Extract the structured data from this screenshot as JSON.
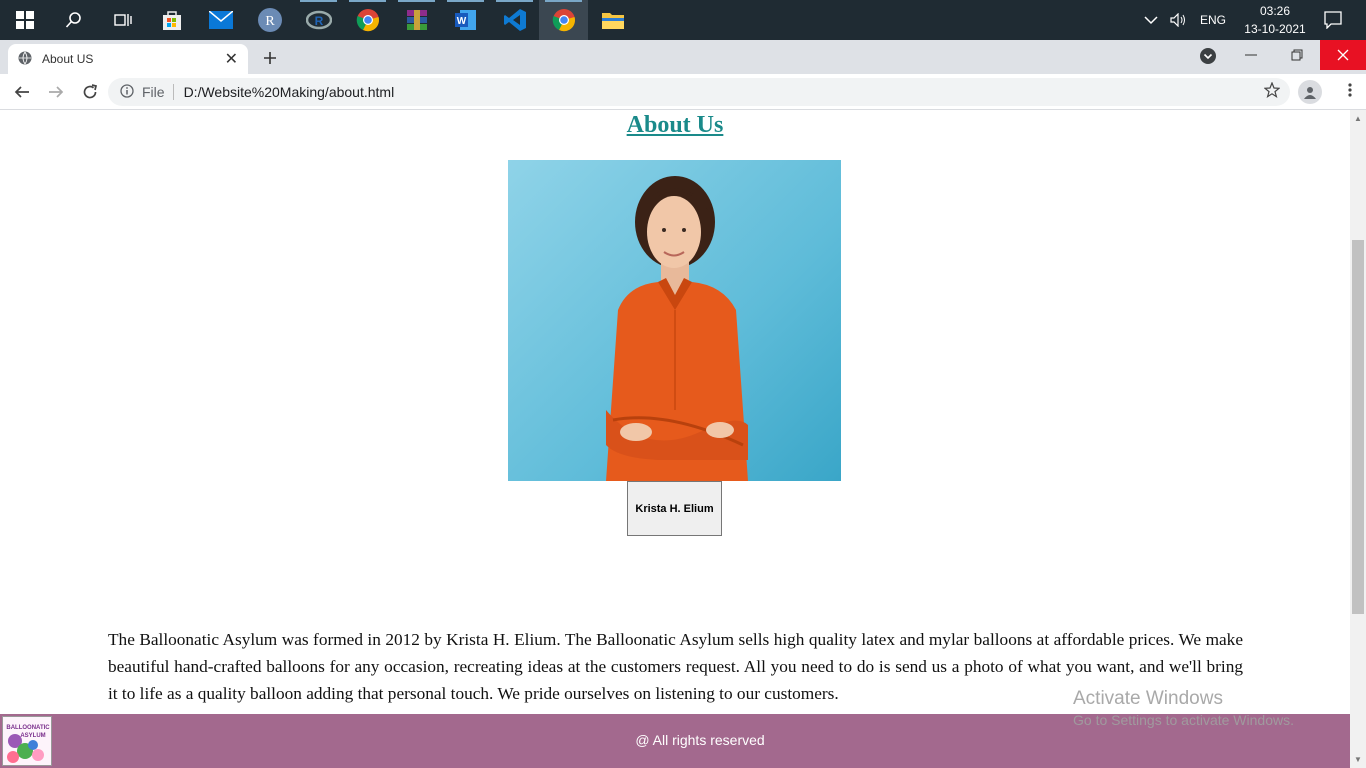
{
  "taskbar": {
    "apps": [
      "start-icon",
      "search-icon",
      "task-view-icon",
      "store-icon",
      "mail-icon",
      "r-icon",
      "rstudio-icon",
      "chrome-icon",
      "winrar-icon",
      "word-icon",
      "vscode-icon",
      "chrome-active-icon",
      "file-explorer-icon"
    ],
    "tray": {
      "language": "ENG",
      "time": "03:26",
      "date": "13-10-2021"
    }
  },
  "browser": {
    "tab_title": "About US",
    "url_prefix": "File",
    "url": "D:/Website%20Making/about.html"
  },
  "page": {
    "heading": "About Us",
    "person_name": "Krista H. Elium",
    "description": "The Balloonatic Asylum was formed in 2012 by Krista H. Elium. The Balloonatic Asylum sells high quality latex and mylar balloons at affordable prices. We make beautiful hand-crafted balloons for any occasion, recreating ideas at the customers request. All you need to do is send us a photo of what you want, and we'll bring it to life as a quality balloon adding that personal touch. We pride ourselves on listening to our customers.",
    "footer_text": "@ All rights reserved",
    "logo_text": "BALLOONATIC ASYLUM"
  },
  "overlay": {
    "activate_title": "Activate Windows",
    "activate_sub": "Go to Settings to activate Windows."
  },
  "colors": {
    "heading": "#1a8a8a",
    "footer": "#a3698e",
    "taskbar": "#1f2b33"
  }
}
